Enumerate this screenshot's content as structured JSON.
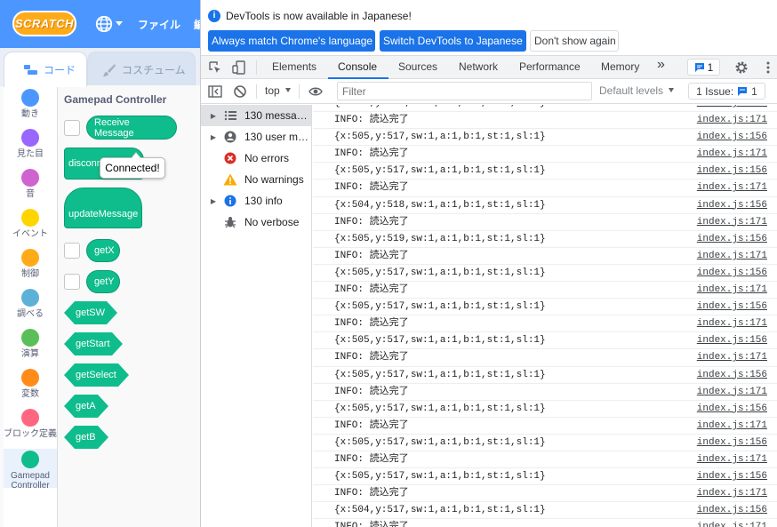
{
  "scratch": {
    "logo": "SCRATCH",
    "menu_file": "ファイル",
    "menu_edit": "編",
    "tabs": {
      "code": "コード",
      "costume": "コスチューム"
    },
    "categories": [
      {
        "label": "動き",
        "color": "#4c97ff"
      },
      {
        "label": "見た目",
        "color": "#9966ff"
      },
      {
        "label": "音",
        "color": "#cf63cf"
      },
      {
        "label": "イベント",
        "color": "#ffd500"
      },
      {
        "label": "制御",
        "color": "#ffab19"
      },
      {
        "label": "調べる",
        "color": "#5cb1d6"
      },
      {
        "label": "演算",
        "color": "#59c059"
      },
      {
        "label": "変数",
        "color": "#ff8c1a"
      },
      {
        "label": "ブロック定義",
        "color": "#ff6680"
      },
      {
        "label": "Gamepad Controller",
        "color": "#0fbd8c"
      }
    ],
    "palette": {
      "title": "Gamepad Controller",
      "receive_message": "Receive Message",
      "disconnect": "disconn",
      "update_message": "updateMessage",
      "get_x": "getX",
      "get_y": "getY",
      "get_sw": "getSW",
      "get_start": "getStart",
      "get_select": "getSelect",
      "get_a": "getA",
      "get_b": "getB"
    },
    "tooltip": "Connected!"
  },
  "devtools": {
    "infobar": {
      "text": "DevTools is now available in Japanese!",
      "btn_match": "Always match Chrome's language",
      "btn_switch": "Switch DevTools to Japanese",
      "btn_dismiss": "Don't show again"
    },
    "tabs": [
      "Elements",
      "Console",
      "Sources",
      "Network",
      "Performance",
      "Memory"
    ],
    "more_tabs": "»",
    "messages_badge": "1",
    "toolbar": {
      "context": "top",
      "filter_placeholder": "Filter",
      "levels": "Default levels",
      "issues": "1 Issue:",
      "issues_count": "1"
    },
    "sidebar": [
      {
        "label": "130 messa…",
        "expandable": true,
        "icon": "list-icon",
        "selected": true
      },
      {
        "label": "130 user m…",
        "expandable": true,
        "icon": "user-icon",
        "selected": false
      },
      {
        "label": "No errors",
        "expandable": false,
        "icon": "error-icon",
        "selected": false
      },
      {
        "label": "No warnings",
        "expandable": false,
        "icon": "warning-icon",
        "selected": false
      },
      {
        "label": "130 info",
        "expandable": true,
        "icon": "info-icon",
        "selected": false
      },
      {
        "label": "No verbose",
        "expandable": false,
        "icon": "bug-icon",
        "selected": false
      }
    ],
    "log": [
      {
        "msg": "{x:504,y:517,sw:1,a:1,b:1,st:1,sl:1}",
        "src": "index.js:156"
      },
      {
        "msg": "INFO: 読込完了",
        "src": "index.js:171"
      },
      {
        "msg": "{x:505,y:517,sw:1,a:1,b:1,st:1,sl:1}",
        "src": "index.js:156"
      },
      {
        "msg": "INFO: 読込完了",
        "src": "index.js:171"
      },
      {
        "msg": "{x:505,y:517,sw:1,a:1,b:1,st:1,sl:1}",
        "src": "index.js:156"
      },
      {
        "msg": "INFO: 読込完了",
        "src": "index.js:171"
      },
      {
        "msg": "{x:504,y:518,sw:1,a:1,b:1,st:1,sl:1}",
        "src": "index.js:156"
      },
      {
        "msg": "INFO: 読込完了",
        "src": "index.js:171"
      },
      {
        "msg": "{x:505,y:519,sw:1,a:1,b:1,st:1,sl:1}",
        "src": "index.js:156"
      },
      {
        "msg": "INFO: 読込完了",
        "src": "index.js:171"
      },
      {
        "msg": "{x:505,y:517,sw:1,a:1,b:1,st:1,sl:1}",
        "src": "index.js:156"
      },
      {
        "msg": "INFO: 読込完了",
        "src": "index.js:171"
      },
      {
        "msg": "{x:505,y:517,sw:1,a:1,b:1,st:1,sl:1}",
        "src": "index.js:156"
      },
      {
        "msg": "INFO: 読込完了",
        "src": "index.js:171"
      },
      {
        "msg": "{x:505,y:517,sw:1,a:1,b:1,st:1,sl:1}",
        "src": "index.js:156"
      },
      {
        "msg": "INFO: 読込完了",
        "src": "index.js:171"
      },
      {
        "msg": "{x:505,y:517,sw:1,a:1,b:1,st:1,sl:1}",
        "src": "index.js:156"
      },
      {
        "msg": "INFO: 読込完了",
        "src": "index.js:171"
      },
      {
        "msg": "{x:505,y:517,sw:1,a:1,b:1,st:1,sl:1}",
        "src": "index.js:156"
      },
      {
        "msg": "INFO: 読込完了",
        "src": "index.js:171"
      },
      {
        "msg": "{x:505,y:517,sw:1,a:1,b:1,st:1,sl:1}",
        "src": "index.js:156"
      },
      {
        "msg": "INFO: 読込完了",
        "src": "index.js:171"
      },
      {
        "msg": "{x:505,y:517,sw:1,a:1,b:1,st:1,sl:1}",
        "src": "index.js:156"
      },
      {
        "msg": "INFO: 読込完了",
        "src": "index.js:171"
      },
      {
        "msg": "{x:504,y:517,sw:1,a:1,b:1,st:1,sl:1}",
        "src": "index.js:156"
      },
      {
        "msg": "INFO: 読込完了",
        "src": "index.js:171"
      }
    ]
  }
}
